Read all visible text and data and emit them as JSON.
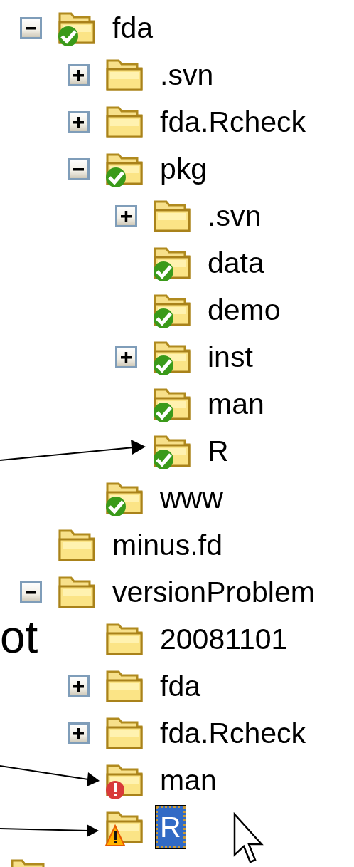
{
  "tree": [
    {
      "label": "fda",
      "kind": "ok",
      "expanded": true,
      "selected": false,
      "children": [
        {
          "label": ".svn",
          "kind": "plain",
          "expanded": false,
          "selected": false
        },
        {
          "label": "fda.Rcheck",
          "kind": "plain",
          "expanded": false,
          "selected": false
        },
        {
          "label": "pkg",
          "kind": "ok",
          "expanded": true,
          "selected": false,
          "children": [
            {
              "label": ".svn",
              "kind": "plain",
              "expanded": false,
              "selected": false
            },
            {
              "label": "data",
              "kind": "ok",
              "selected": false
            },
            {
              "label": "demo",
              "kind": "ok",
              "selected": false
            },
            {
              "label": "inst",
              "kind": "ok",
              "expanded": false,
              "selected": false
            },
            {
              "label": "man",
              "kind": "ok",
              "selected": false
            },
            {
              "label": "R",
              "kind": "ok",
              "selected": false
            }
          ]
        },
        {
          "label": "www",
          "kind": "ok",
          "selected": false
        }
      ]
    },
    {
      "label": "minus.fd",
      "kind": "plain",
      "selected": false
    },
    {
      "label": "versionProblem",
      "kind": "plain",
      "expanded": true,
      "selected": false,
      "children": [
        {
          "label": "20081101",
          "kind": "plain",
          "selected": false
        },
        {
          "label": "fda",
          "kind": "plain",
          "expanded": false,
          "selected": false
        },
        {
          "label": "fda.Rcheck",
          "kind": "plain",
          "expanded": false,
          "selected": false
        },
        {
          "label": "man",
          "kind": "conflict",
          "selected": false
        },
        {
          "label": "R",
          "kind": "warning",
          "selected": true
        }
      ]
    }
  ],
  "annotation": {
    "text": "ot"
  }
}
